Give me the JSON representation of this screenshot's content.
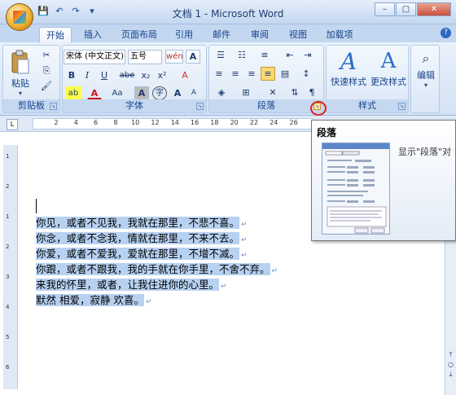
{
  "window": {
    "title": "文档 1 - Microsoft Word",
    "minimize": "–",
    "maximize": "▢",
    "close": "✕"
  },
  "qat": {
    "save": "💾",
    "undo": "↶",
    "redo": "↷",
    "more": "▾"
  },
  "tabs": [
    "开始",
    "插入",
    "页面布局",
    "引用",
    "邮件",
    "审阅",
    "视图",
    "加载项"
  ],
  "help": "?",
  "clipboard": {
    "paste_label": "粘贴",
    "group_label": "剪贴板",
    "cut": "✂",
    "copy": "⎘",
    "format_painter": "🖌"
  },
  "font": {
    "font_name": "宋体 (中文正文)",
    "font_size": "五号",
    "phonetic": "wén",
    "border_char": "A",
    "bold": "B",
    "italic": "I",
    "underline": "U",
    "strike": "abe",
    "subscript": "x₂",
    "superscript": "x²",
    "clear_format": "A",
    "highlight": "ab",
    "font_color": "A",
    "change_case": "Aa",
    "char_shading": "A",
    "enclosed": "字",
    "grow": "A",
    "shrink": "A",
    "group_label": "字体"
  },
  "paragraph": {
    "group_label": "段落"
  },
  "styles": {
    "quick_styles": "快速样式",
    "change_styles": "更改样式",
    "group_label": "样式"
  },
  "editing": {
    "label": "编辑"
  },
  "ruler": {
    "ticks": [
      "2",
      "4",
      "6",
      "8",
      "10",
      "12",
      "14",
      "16",
      "18",
      "20",
      "22",
      "24",
      "26"
    ],
    "tab_selector": "L"
  },
  "vruler": {
    "ticks": [
      "1",
      "2",
      "1",
      "2",
      "3",
      "4",
      "5",
      "6"
    ]
  },
  "document": {
    "lines": [
      "你见，或者不见我，我就在那里，不悲不喜。",
      "你念，或者不念我，情就在那里，不来不去。",
      "你爱，或者不爱我，爱就在那里，不增不减。",
      "你跟，或者不跟我，我的手就在你手里，不舍不弃。",
      "来我的怀里，或者，让我住进你的心里。",
      "默然  相爱，寂静  欢喜。"
    ],
    "para_mark": "↵"
  },
  "tooltip": {
    "title": "段落",
    "description": "显示\"段落\"对"
  }
}
